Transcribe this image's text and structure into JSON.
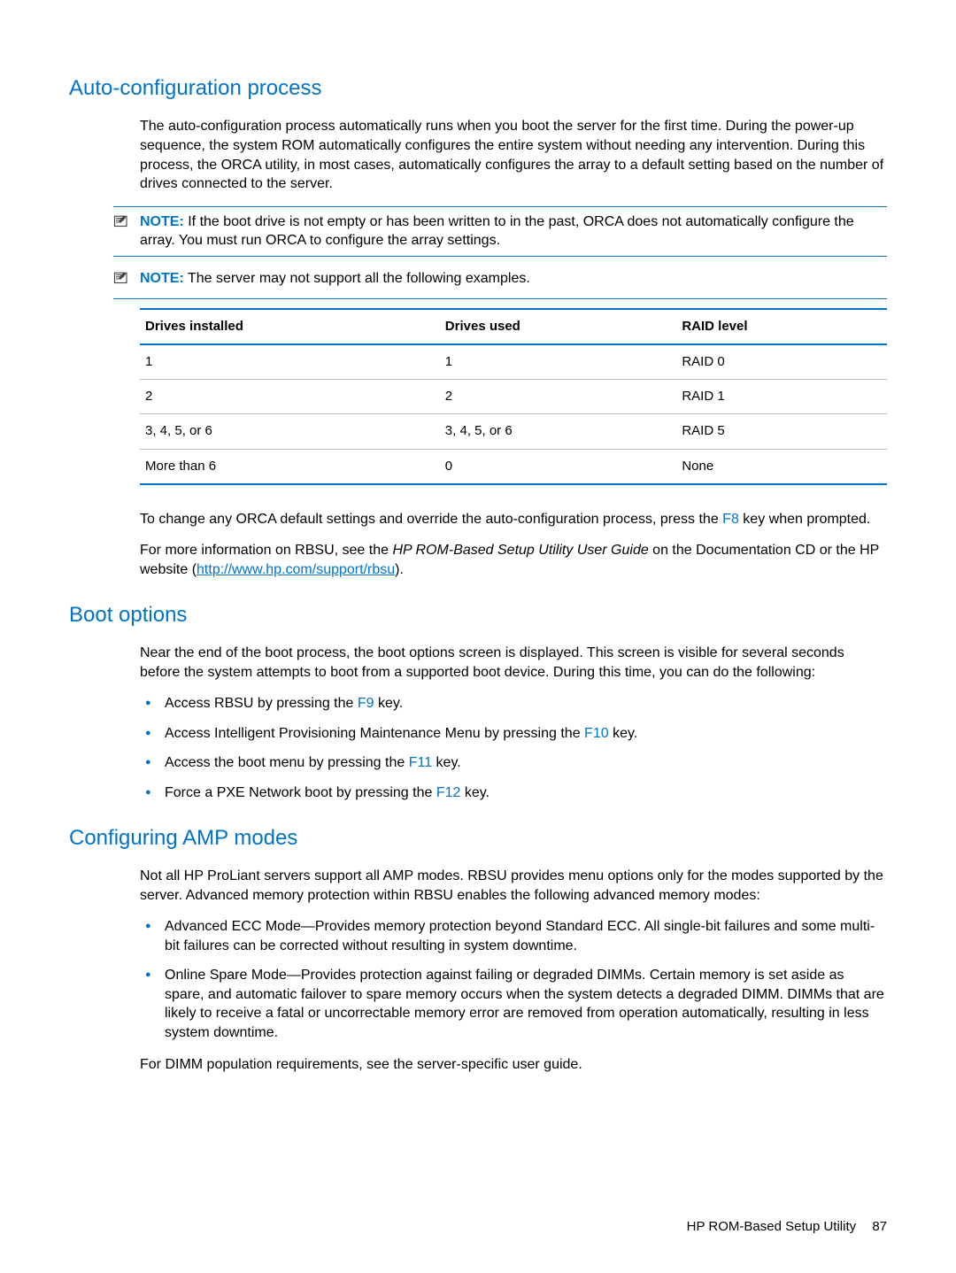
{
  "sections": {
    "auto": {
      "title": "Auto-configuration process",
      "para1": "The auto-configuration process automatically runs when you boot the server for the first time. During the power-up sequence, the system ROM automatically configures the entire system without needing any intervention. During this process, the ORCA utility, in most cases, automatically configures the array to a default setting based on the number of drives connected to the server.",
      "note1_label": "NOTE:",
      "note1_text": "If the boot drive is not empty or has been written to in the past, ORCA does not automatically configure the array. You must run ORCA to configure the array settings.",
      "note2_label": "NOTE:",
      "note2_text": "The server may not support all the following examples.",
      "table": {
        "headers": [
          "Drives installed",
          "Drives used",
          "RAID level"
        ],
        "rows": [
          [
            "1",
            "1",
            "RAID 0"
          ],
          [
            "2",
            "2",
            "RAID 1"
          ],
          [
            "3, 4, 5, or 6",
            "3, 4, 5, or 6",
            "RAID 5"
          ],
          [
            "More than 6",
            "0",
            "None"
          ]
        ]
      },
      "para2_a": "To change any ORCA default settings and override the auto-configuration process, press the ",
      "para2_key": "F8",
      "para2_b": " key when prompted.",
      "para3_a": "For more information on RBSU, see the ",
      "para3_doc": "HP ROM-Based Setup Utility User Guide",
      "para3_b": " on the Documentation CD or the HP website (",
      "para3_link": "http://www.hp.com/support/rbsu",
      "para3_c": ")."
    },
    "boot": {
      "title": "Boot options",
      "para1": "Near the end of the boot process, the boot options screen is displayed. This screen is visible for several seconds before the system attempts to boot from a supported boot device. During this time, you can do the following:",
      "items": [
        {
          "pre": "Access RBSU by pressing the ",
          "key": "F9",
          "post": " key."
        },
        {
          "pre": "Access Intelligent Provisioning Maintenance Menu by pressing the ",
          "key": "F10",
          "post": " key."
        },
        {
          "pre": "Access the boot menu by pressing the ",
          "key": "F11",
          "post": " key."
        },
        {
          "pre": "Force a PXE Network boot by pressing the ",
          "key": "F12",
          "post": " key."
        }
      ]
    },
    "amp": {
      "title": "Configuring AMP modes",
      "para1": "Not all HP ProLiant servers support all AMP modes. RBSU provides menu options only for the modes supported by the server. Advanced memory protection within RBSU enables the following advanced memory modes:",
      "items": [
        "Advanced ECC Mode—Provides memory protection beyond Standard ECC. All single-bit failures and some multi-bit failures can be corrected without resulting in system downtime.",
        "Online Spare Mode—Provides protection against failing or degraded DIMMs. Certain memory is set aside as spare, and automatic failover to spare memory occurs when the system detects a degraded DIMM. DIMMs that are likely to receive a fatal or uncorrectable memory error are removed from operation automatically, resulting in less system downtime."
      ],
      "para2": "For DIMM population requirements, see the server-specific user guide."
    }
  },
  "footer": {
    "text": "HP ROM-Based Setup Utility",
    "page": "87"
  }
}
